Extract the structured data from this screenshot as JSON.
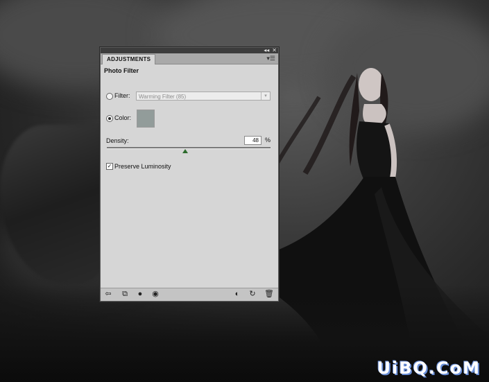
{
  "panel": {
    "tab_label": "ADJUSTMENTS",
    "title": "Photo Filter",
    "filter_label": "Filter:",
    "filter_value": "Warming Filter (85)",
    "filter_selected": false,
    "color_label": "Color:",
    "color_selected": true,
    "color_value": "#929c9a",
    "density_label": "Density:",
    "density_value": "48",
    "density_unit": "%",
    "preserve_label": "Preserve Luminosity",
    "preserve_checked": true
  },
  "window_buttons": {
    "collapse": "◂◂",
    "close": "✕"
  },
  "watermark": "UiBQ.CoM"
}
